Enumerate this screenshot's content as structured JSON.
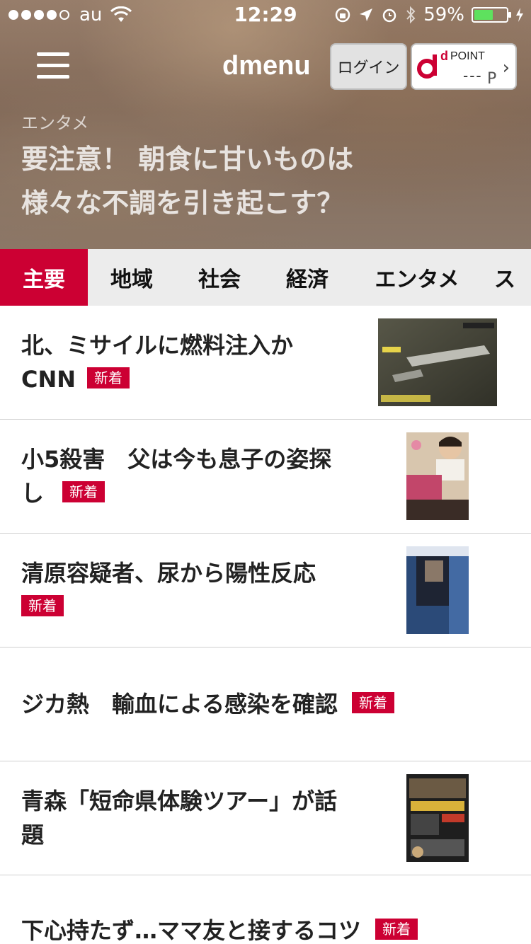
{
  "status": {
    "carrier": "au",
    "time": "12:29",
    "battery": "59%",
    "battery_level": 0.59
  },
  "header": {
    "logo": "dmenu",
    "login_label": "ログイン",
    "dpoint_small": "d",
    "dpoint_word": "POINT",
    "dpoint_value": "---",
    "dpoint_unit": "P"
  },
  "hero": {
    "category": "エンタメ",
    "title_line1": "要注意！ 朝食に甘いものは",
    "title_line2": "様々な不調を引き起こす？"
  },
  "tabs": [
    {
      "label": "主要"
    },
    {
      "label": "地域"
    },
    {
      "label": "社会"
    },
    {
      "label": "経済"
    },
    {
      "label": "エンタメ"
    },
    {
      "label": "ス"
    }
  ],
  "news": [
    {
      "title": "北、ミサイルに燃料注入か",
      "title2": "CNN",
      "badge": "新着"
    },
    {
      "title": "小5殺害　父は今も息子の姿探",
      "title2": "し",
      "badge": "新着"
    },
    {
      "title": "清原容疑者、尿から陽性反応",
      "badge": "新着"
    },
    {
      "title": "ジカ熱　輸血による感染を確認",
      "badge": "新着"
    },
    {
      "title": "青森「短命県体験ツアー」が話",
      "title2": "題"
    },
    {
      "title": "下心持たず…ママ友と接するコツ",
      "badge": "新着"
    }
  ]
}
